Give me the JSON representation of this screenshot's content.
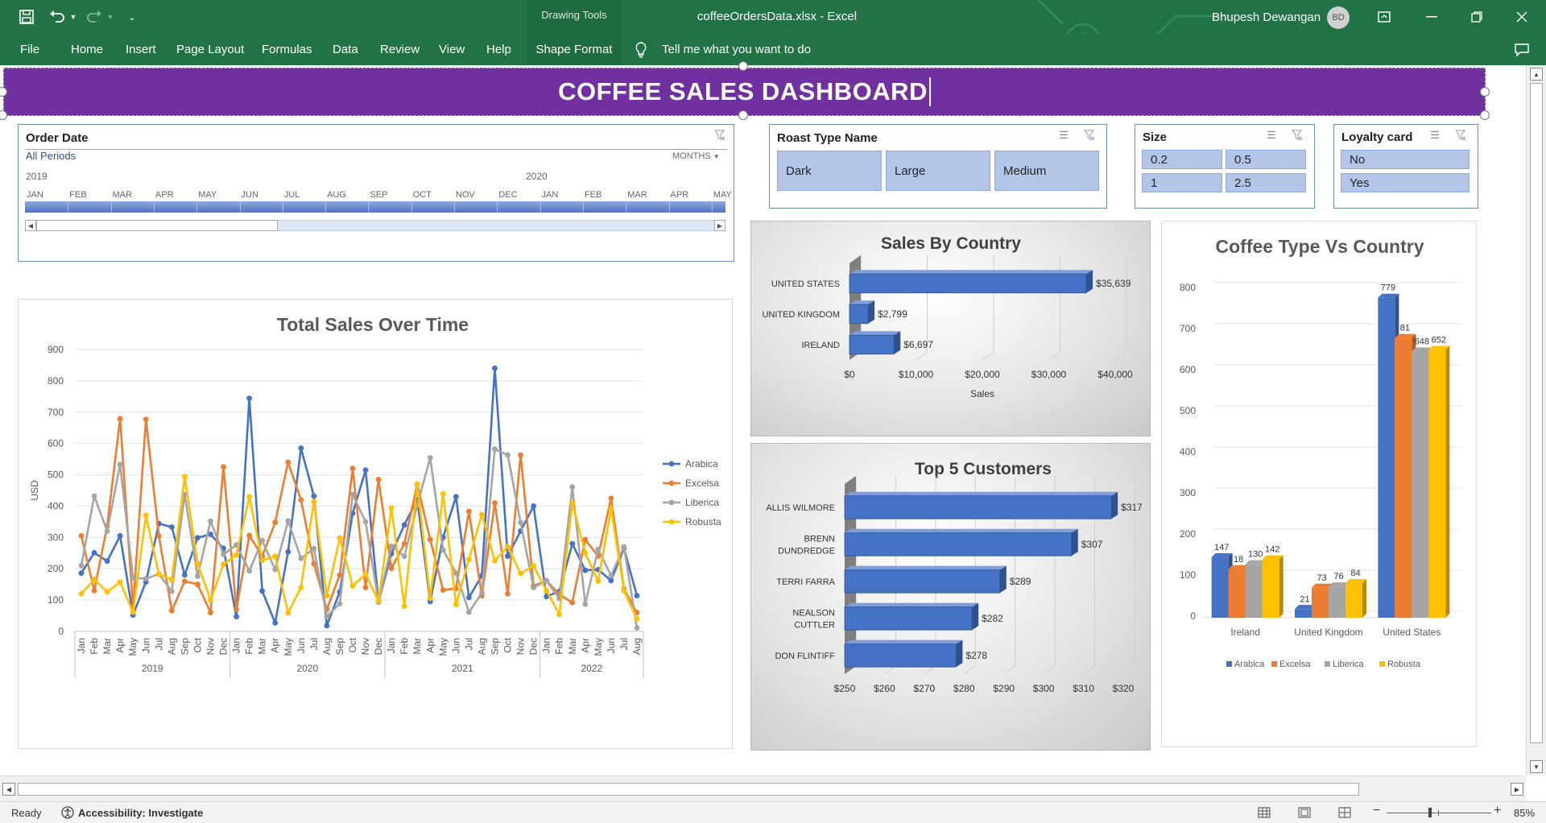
{
  "titlebar": {
    "drawing_tools": "Drawing Tools",
    "doc_title": "coffeeOrdersData.xlsx  -  Excel",
    "user_name": "Bhupesh Dewangan",
    "user_initials": "BD"
  },
  "ribbon": {
    "tabs": [
      "File",
      "Home",
      "Insert",
      "Page Layout",
      "Formulas",
      "Data",
      "Review",
      "View",
      "Help",
      "Shape Format"
    ],
    "tell_me": "Tell me what you want to do"
  },
  "banner": {
    "title": "COFFEE SALES DASHBOARD",
    "color": "#7030a0"
  },
  "order_date": {
    "title": "Order Date",
    "all_periods": "All Periods",
    "level": "MONTHS",
    "year1": "2019",
    "year2": "2020",
    "months": [
      "JAN",
      "FEB",
      "MAR",
      "APR",
      "MAY",
      "JUN",
      "JUL",
      "AUG",
      "SEP",
      "OCT",
      "NOV",
      "DEC",
      "JAN",
      "FEB",
      "MAR",
      "APR",
      "MAY"
    ]
  },
  "roast": {
    "title": "Roast Type Name",
    "items": [
      "Dark",
      "Large",
      "Medium"
    ]
  },
  "size": {
    "title": "Size",
    "items": [
      "0.2",
      "0.5",
      "1",
      "2.5"
    ]
  },
  "loyalty": {
    "title": "Loyalty card",
    "items": [
      "No",
      "Yes"
    ]
  },
  "status": {
    "ready": "Ready",
    "accessibility": "Accessibility: Investigate",
    "zoom": "85%"
  },
  "chart_data": [
    {
      "type": "line",
      "title": "Total Sales Over Time",
      "ylabel": "USD",
      "ylim": [
        0,
        900
      ],
      "yticks": [
        0,
        100,
        200,
        300,
        400,
        500,
        600,
        700,
        800,
        900
      ],
      "months": [
        "Jan",
        "Feb",
        "Mar",
        "Apr",
        "May",
        "Jun",
        "Jul",
        "Aug",
        "Sep",
        "Oct",
        "Nov",
        "Dec",
        "Jan",
        "Feb",
        "Mar",
        "Apr",
        "May",
        "Jun",
        "Jul",
        "Aug",
        "Sep",
        "Oct",
        "Nov",
        "Dec",
        "Jan",
        "Feb",
        "Mar",
        "Apr",
        "May",
        "Jun",
        "Jul",
        "Aug",
        "Sep",
        "Oct",
        "Nov",
        "Dec",
        "Jan",
        "Feb",
        "Mar",
        "Apr",
        "May",
        "Jun",
        "Jul",
        "Aug"
      ],
      "years": [
        {
          "label": "2019",
          "count": 12
        },
        {
          "label": "2020",
          "count": 12
        },
        {
          "label": "2021",
          "count": 12
        },
        {
          "label": "2022",
          "count": 8
        }
      ],
      "series": [
        {
          "name": "Arabica",
          "color": "#4472c4",
          "values": [
            186,
            251,
            224,
            305,
            52,
            158,
            344,
            333,
            180,
            299,
            310,
            265,
            47,
            744,
            129,
            27,
            254,
            585,
            432,
            18,
            126,
            377,
            515,
            94,
            248,
            340,
            421,
            95,
            300,
            430,
            108,
            178,
            840,
            240,
            320,
            400,
            111,
            128,
            280,
            195,
            197,
            162,
            265,
            114
          ]
        },
        {
          "name": "Excelsa",
          "color": "#ed7d31",
          "values": [
            305,
            130,
            336,
            679,
            73,
            677,
            305,
            66,
            160,
            150,
            60,
            525,
            70,
            306,
            240,
            348,
            540,
            420,
            216,
            70,
            180,
            520,
            140,
            485,
            201,
            280,
            470,
            293,
            132,
            137,
            383,
            114,
            410,
            120,
            563,
            145,
            162,
            118,
            92,
            293,
            240,
            425,
            135,
            60
          ]
        },
        {
          "name": "Liberica",
          "color": "#a5a5a5",
          "values": [
            210,
            432,
            320,
            533,
            171,
            168,
            183,
            128,
            437,
            176,
            352,
            246,
            276,
            193,
            290,
            197,
            353,
            233,
            264,
            48,
            88,
            437,
            350,
            93,
            272,
            240,
            403,
            554,
            260,
            186,
            61,
            123,
            582,
            563,
            347,
            140,
            161,
            105,
            461,
            87,
            262,
            178,
            270,
            11
          ]
        },
        {
          "name": "Robusta",
          "color": "#ffc000",
          "values": [
            120,
            166,
            126,
            157,
            61,
            371,
            182,
            165,
            494,
            216,
            100,
            214,
            244,
            430,
            227,
            240,
            59,
            140,
            415,
            114,
            298,
            145,
            183,
            97,
            394,
            80,
            470,
            106,
            439,
            86,
            230,
            373,
            225,
            271,
            185,
            209,
            130,
            54,
            409,
            250,
            160,
            392,
            130,
            40
          ]
        }
      ]
    },
    {
      "type": "bar",
      "title": "Sales By Country",
      "xlabel": "Sales",
      "categories": [
        "UNITED STATES",
        "UNITED KINGDOM",
        "IRELAND"
      ],
      "values": [
        35639,
        2799,
        6697
      ],
      "labels": [
        "$35,639",
        "$2,799",
        "$6,697"
      ],
      "xticks": [
        "$0",
        "$10,000",
        "$20,000",
        "$30,000",
        "$40,000"
      ],
      "xlim": [
        0,
        40000
      ]
    },
    {
      "type": "bar",
      "title": "Top 5 Customers",
      "categories": [
        [
          "ALLIS WILMORE"
        ],
        [
          "BRENN",
          "DUNDREDGE"
        ],
        [
          "TERRI FARRA"
        ],
        [
          "NEALSON",
          "CUTTLER"
        ],
        [
          "DON FLINTIFF"
        ]
      ],
      "values": [
        317,
        307,
        289,
        282,
        278
      ],
      "labels": [
        "$317",
        "$307",
        "$289",
        "$282",
        "$278"
      ],
      "xticks": [
        "$250",
        "$260",
        "$270",
        "$280",
        "$290",
        "$300",
        "$310",
        "$320"
      ],
      "xlim": [
        250,
        320
      ]
    },
    {
      "type": "bar",
      "title": "Coffee Type Vs Country",
      "categories": [
        "Ireland",
        "United Kingdom",
        "United States"
      ],
      "ylim": [
        0,
        800
      ],
      "yticks": [
        0,
        100,
        200,
        300,
        400,
        500,
        600,
        700,
        800
      ],
      "series": [
        {
          "name": "Arabica",
          "color": "#4472c4",
          "values": [
            147,
            21,
            779
          ],
          "labels": [
            "147",
            "21",
            "779"
          ]
        },
        {
          "name": "Excelsa",
          "color": "#ed7d31",
          "values": [
            118,
            73,
            681
          ],
          "labels": [
            "18",
            "73",
            "81"
          ]
        },
        {
          "name": "Liberica",
          "color": "#a5a5a5",
          "values": [
            130,
            76,
            648
          ],
          "labels": [
            "130",
            "76",
            "648"
          ]
        },
        {
          "name": "Robusta",
          "color": "#ffc000",
          "values": [
            142,
            84,
            652
          ],
          "labels": [
            "142",
            "84",
            "652"
          ]
        }
      ]
    }
  ]
}
